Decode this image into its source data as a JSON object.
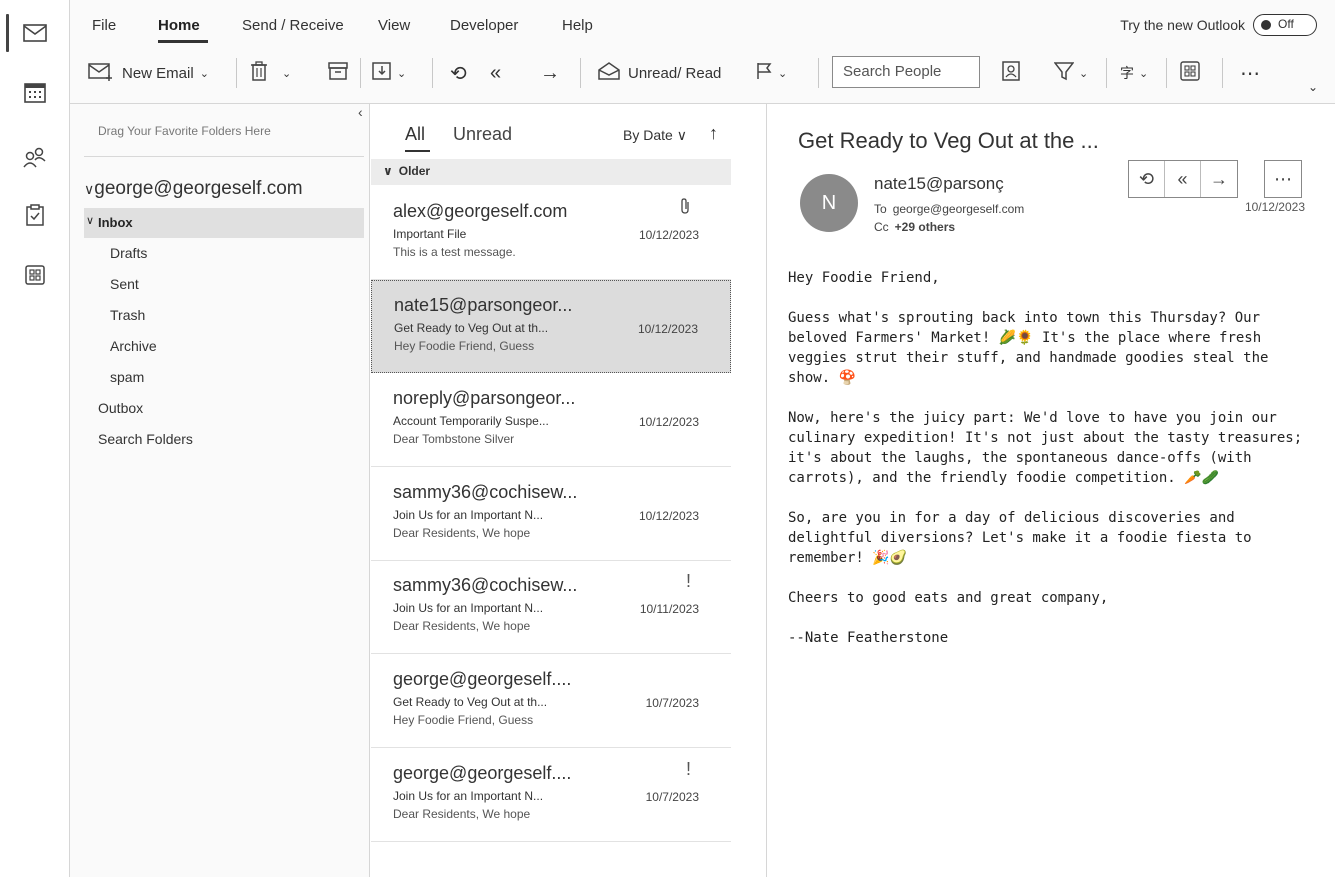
{
  "ribbon": {
    "tabs": [
      "File",
      "Home",
      "Send / Receive",
      "View",
      "Developer",
      "Help"
    ],
    "try_new": "Try the new Outlook",
    "toggle_label": "Off",
    "new_email": "New Email",
    "unread_read": "Unread/ Read",
    "search_people_placeholder": "Search People"
  },
  "folders": {
    "drag_hint": "Drag Your Favorite Folders Here",
    "account": "george@georgeself.com",
    "inbox": "Inbox",
    "subfolders": [
      "Drafts",
      "Sent",
      "Trash",
      "Archive",
      "spam"
    ],
    "outbox": "Outbox",
    "search_folders": "Search Folders"
  },
  "list": {
    "filter_all": "All",
    "filter_unread": "Unread",
    "sort": "By Date",
    "group": "Older",
    "messages": [
      {
        "from": "alex@georgeself.com",
        "subject": "Important File",
        "preview": "This is a test message.",
        "date": "10/12/2023",
        "mark": "attachment"
      },
      {
        "from": "nate15@parsongeor...",
        "subject": "Get Ready to Veg Out at th...",
        "preview": "Hey Foodie Friend,  Guess",
        "date": "10/12/2023",
        "mark": ""
      },
      {
        "from": "noreply@parsongeor...",
        "subject": "Account Temporarily Suspe...",
        "preview": "Dear Tombstone Silver",
        "date": "10/12/2023",
        "mark": ""
      },
      {
        "from": "sammy36@cochisew...",
        "subject": "Join Us for an Important N...",
        "preview": "Dear Residents,  We hope",
        "date": "10/12/2023",
        "mark": ""
      },
      {
        "from": "sammy36@cochisew...",
        "subject": "Join Us for an Important N...",
        "preview": "Dear Residents,  We hope",
        "date": "10/11/2023",
        "mark": "!"
      },
      {
        "from": "george@georgeself....",
        "subject": "Get Ready to Veg Out at th...",
        "preview": "Hey Foodie Friend,  Guess",
        "date": "10/7/2023",
        "mark": ""
      },
      {
        "from": "george@georgeself....",
        "subject": "Join Us for an Important N...",
        "preview": "Dear Residents,  We hope",
        "date": "10/7/2023",
        "mark": "!"
      }
    ]
  },
  "reader": {
    "subject": "Get Ready to Veg Out at the ...",
    "avatar_initial": "N",
    "from": "nate15@parsonç",
    "to_label": "To",
    "to": "george@georgeself.com",
    "cc_label": "Cc",
    "cc": "+29 others",
    "date": "10/12/2023",
    "body": [
      "Hey Foodie Friend,",
      "Guess what's sprouting back into town this Thursday? Our beloved Farmers' Market! 🌽🌻 It's the place where fresh veggies strut their stuff, and handmade goodies steal the show. 🍄",
      "Now, here's the juicy part: We'd love to have you join our culinary expedition! It's not just about the tasty treasures; it's about the laughs, the spontaneous dance-offs (with carrots), and the friendly foodie competition. 🥕🥒",
      "So, are you in for a day of delicious discoveries and delightful diversions? Let's make it a foodie fiesta to remember! 🎉🥑",
      "Cheers to good eats and great company,",
      "--Nate Featherstone"
    ]
  },
  "colors": {
    "selected_row": "#dcdcdc",
    "inbox_row": "#e0e0e0",
    "avatar": "#8a8a8a"
  }
}
